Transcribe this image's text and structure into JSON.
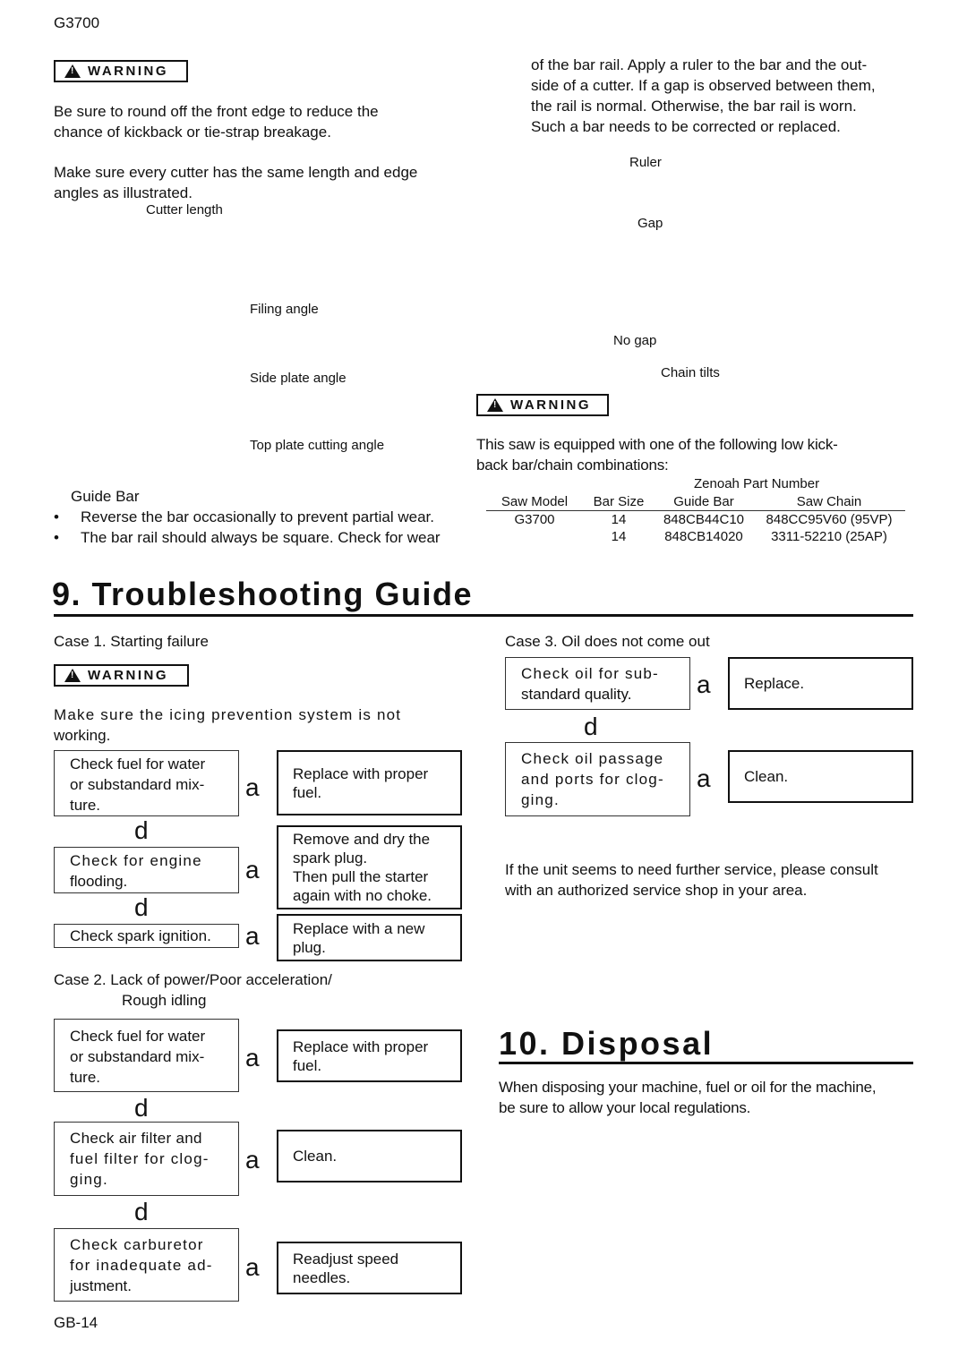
{
  "header": {
    "model": "G3700"
  },
  "footer": {
    "page_number": "GB-14"
  },
  "warning_label": "WARNING",
  "left_top": {
    "warning_text": [
      "Be sure to round off the front edge to reduce the",
      "chance of kickback or tie-strap breakage."
    ],
    "cutter_text": [
      "Make sure every cutter has the same length and edge",
      "angles as illustrated."
    ],
    "figure_labels": {
      "cutter_length": "Cutter length",
      "filing_angle": "Filing angle",
      "side_plate_angle": "Side plate angle",
      "top_plate_cutting_angle": "Top plate cutting angle"
    },
    "guide_bar": {
      "heading": "Guide Bar",
      "bullets": [
        "Reverse the bar occasionally to prevent partial wear.",
        "The bar rail should always be square. Check for wear"
      ]
    }
  },
  "right_top": {
    "continued_text": [
      "of the bar rail. Apply a ruler to the bar and the out-",
      "side of a cutter. If a gap is observed between them,",
      "the rail is normal. Otherwise, the bar rail is worn.",
      "Such a bar needs to be corrected or replaced."
    ],
    "figure_labels": {
      "ruler": "Ruler",
      "gap": "Gap",
      "no_gap": "No gap",
      "chain_tilts": "Chain tilts"
    },
    "warning_text": [
      "This saw is equipped with one of the following low kick-",
      "back bar/chain combinations:"
    ],
    "parts_table": {
      "group_header": "Zenoah Part Number",
      "columns": [
        "Saw Model",
        "Bar Size",
        "Guide Bar",
        "Saw Chain"
      ],
      "rows": [
        [
          "G3700",
          "14",
          "848CB44C10",
          "848CC95V60 (95VP)"
        ],
        [
          "",
          "14",
          "848CB14020",
          "3311-52210 (25AP)"
        ]
      ]
    }
  },
  "troubleshooting": {
    "title": "9. Troubleshooting Guide",
    "arrow_right": "a",
    "arrow_down": "d",
    "case1": {
      "title": "Case 1.  Starting failure",
      "warning_text": [
        "Make sure the icing prevention system is not",
        "working."
      ],
      "steps": [
        {
          "check": [
            "Check fuel for water",
            "or substandard mix-",
            "ture."
          ],
          "action": [
            "Replace with proper",
            "fuel."
          ]
        },
        {
          "check": [
            "Check for engine",
            "flooding."
          ],
          "action": [
            "Remove and dry the",
            "spark plug.",
            "Then pull the starter",
            "again with no choke."
          ]
        },
        {
          "check": [
            "Check spark ignition."
          ],
          "action": [
            "Replace with a new",
            "plug."
          ]
        }
      ]
    },
    "case2": {
      "title_line1": "Case 2.  Lack of power/Poor acceleration/",
      "title_line2": "Rough idling",
      "steps": [
        {
          "check": [
            "Check fuel for water",
            "or substandard mix-",
            "ture."
          ],
          "action": [
            "Replace with proper",
            "fuel."
          ]
        },
        {
          "check": [
            "Check air filter and",
            "fuel filter for clog-",
            "ging."
          ],
          "action": [
            "Clean."
          ]
        },
        {
          "check": [
            "Check carburetor",
            "for inadequate ad-",
            "justment."
          ],
          "action": [
            "Readjust speed",
            "needles."
          ]
        }
      ]
    },
    "case3": {
      "title": "Case 3.  Oil does not come out",
      "steps": [
        {
          "check": [
            "Check oil for sub-",
            "standard quality."
          ],
          "action": [
            "Replace."
          ]
        },
        {
          "check": [
            "Check oil passage",
            "and ports for clog-",
            "ging."
          ],
          "action": [
            "Clean."
          ]
        }
      ]
    },
    "further_service": [
      "If the unit seems to need further service, please consult",
      "with an authorized service shop in your area."
    ]
  },
  "disposal": {
    "title": "10. Disposal",
    "text": [
      "When disposing your machine, fuel or oil for the machine,",
      "be sure to allow your local regulations."
    ]
  }
}
